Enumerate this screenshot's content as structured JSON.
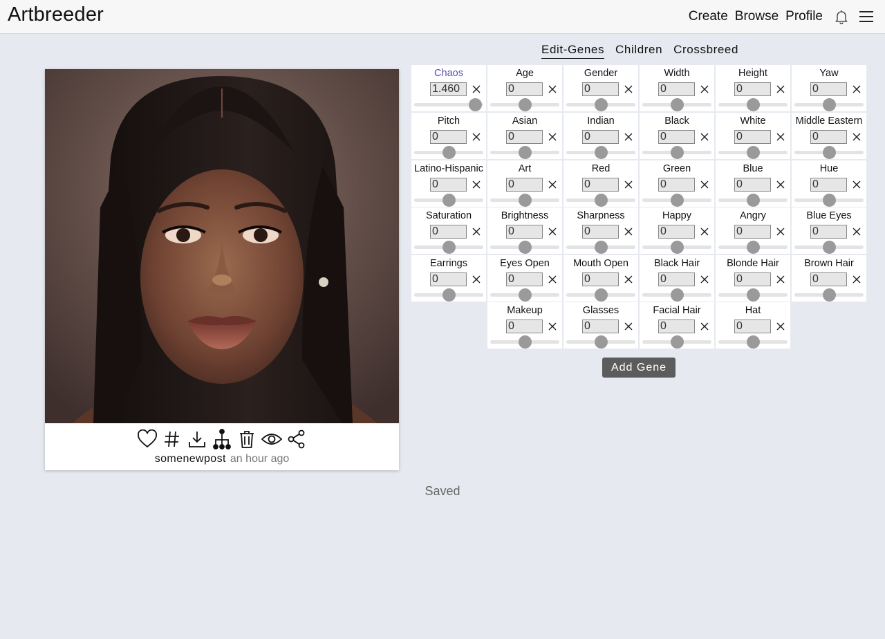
{
  "app": {
    "title": "Artbreeder"
  },
  "nav": {
    "create": "Create",
    "browse": "Browse",
    "profile": "Profile"
  },
  "tabs": [
    {
      "label": "Edit-Genes",
      "active": true
    },
    {
      "label": "Children",
      "active": false
    },
    {
      "label": "Crossbreed",
      "active": false
    }
  ],
  "genes": [
    {
      "label": "Chaos",
      "value": "1.460",
      "level": 0.88,
      "active": true
    },
    {
      "label": "Age",
      "value": "0",
      "level": 0.5
    },
    {
      "label": "Gender",
      "value": "0",
      "level": 0.5
    },
    {
      "label": "Width",
      "value": "0",
      "level": 0.5
    },
    {
      "label": "Height",
      "value": "0",
      "level": 0.5
    },
    {
      "label": "Yaw",
      "value": "0",
      "level": 0.5
    },
    {
      "label": "Pitch",
      "value": "0",
      "level": 0.5
    },
    {
      "label": "Asian",
      "value": "0",
      "level": 0.5
    },
    {
      "label": "Indian",
      "value": "0",
      "level": 0.5
    },
    {
      "label": "Black",
      "value": "0",
      "level": 0.5
    },
    {
      "label": "White",
      "value": "0",
      "level": 0.5
    },
    {
      "label": "Middle Eastern",
      "value": "0",
      "level": 0.5
    },
    {
      "label": "Latino-Hispanic",
      "value": "0",
      "level": 0.5
    },
    {
      "label": "Art",
      "value": "0",
      "level": 0.5
    },
    {
      "label": "Red",
      "value": "0",
      "level": 0.5
    },
    {
      "label": "Green",
      "value": "0",
      "level": 0.5
    },
    {
      "label": "Blue",
      "value": "0",
      "level": 0.5
    },
    {
      "label": "Hue",
      "value": "0",
      "level": 0.5
    },
    {
      "label": "Saturation",
      "value": "0",
      "level": 0.5
    },
    {
      "label": "Brightness",
      "value": "0",
      "level": 0.5
    },
    {
      "label": "Sharpness",
      "value": "0",
      "level": 0.5
    },
    {
      "label": "Happy",
      "value": "0",
      "level": 0.5
    },
    {
      "label": "Angry",
      "value": "0",
      "level": 0.5
    },
    {
      "label": "Blue Eyes",
      "value": "0",
      "level": 0.5
    },
    {
      "label": "Earrings",
      "value": "0",
      "level": 0.5
    },
    {
      "label": "Eyes Open",
      "value": "0",
      "level": 0.5
    },
    {
      "label": "Mouth Open",
      "value": "0",
      "level": 0.5
    },
    {
      "label": "Black Hair",
      "value": "0",
      "level": 0.5
    },
    {
      "label": "Blonde Hair",
      "value": "0",
      "level": 0.5
    },
    {
      "label": "Brown Hair",
      "value": "0",
      "level": 0.5
    },
    {
      "label": "Makeup",
      "value": "0",
      "level": 0.5
    },
    {
      "label": "Glasses",
      "value": "0",
      "level": 0.5
    },
    {
      "label": "Facial Hair",
      "value": "0",
      "level": 0.5
    },
    {
      "label": "Hat",
      "value": "0",
      "level": 0.5
    }
  ],
  "add_gene_label": "Add Gene",
  "post": {
    "username": "somenewpost",
    "time": "an hour ago"
  },
  "status": "Saved",
  "icons": {
    "actions": [
      "heart-icon",
      "hashtag-icon",
      "download-icon",
      "lineage-tree-icon",
      "trash-icon",
      "eye-icon",
      "share-icon"
    ],
    "header": [
      "bell-icon",
      "hamburger-menu-icon"
    ]
  },
  "colors": {
    "active_gene": "#5b4fb0",
    "button": "#5c5c5c",
    "background": "#e6e9ef"
  }
}
